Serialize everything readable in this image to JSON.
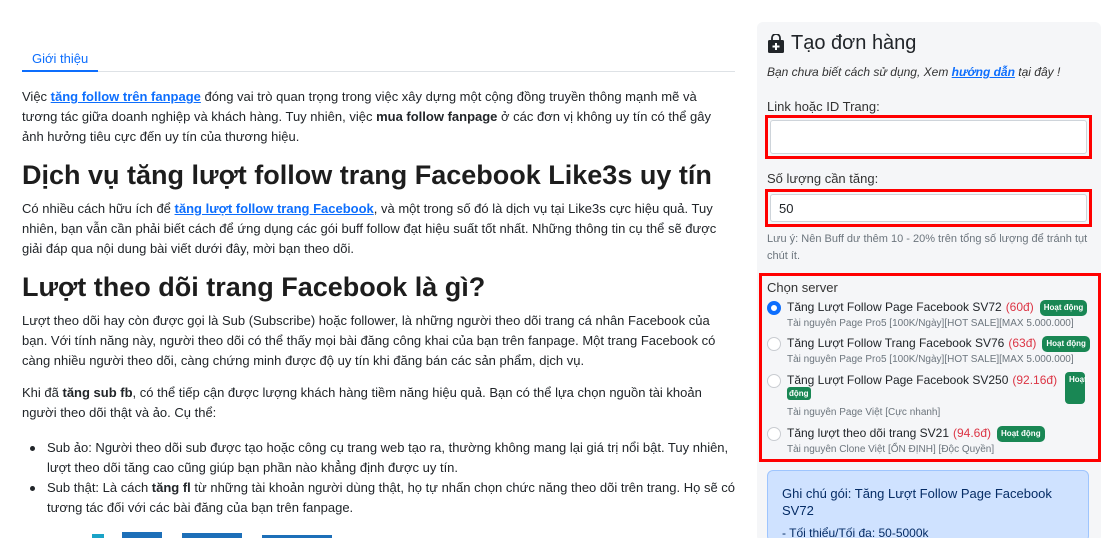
{
  "article": {
    "tab_label": "Giới thiệu",
    "p1": {
      "before": "Việc ",
      "link": "tăng follow trên fanpage",
      "middle": " đóng vai trò quan trọng trong việc xây dựng một cộng đồng truyền thông mạnh mẽ và tương tác giữa doanh nghiệp và khách hàng. Tuy nhiên, việc ",
      "bold": "mua follow fanpage",
      "after": " ở các đơn vị không uy tín có thể gây ảnh hưởng tiêu cực đến uy tín của thương hiệu."
    },
    "h1": "Dịch vụ tăng lượt follow trang Facebook Like3s uy tín",
    "p2": {
      "before": "Có nhiều cách hữu ích để ",
      "link": "tăng lượt follow trang Facebook",
      "after": ", và một trong số đó là dịch vụ tại Like3s cực hiệu quả. Tuy nhiên, bạn vẫn cần phải biết cách để ứng dụng các gói buff follow đạt hiệu suất tốt nhất. Những thông tin cụ thể sẽ được giải đáp qua nội dung bài viết dưới đây, mời bạn theo dõi."
    },
    "h2": "Lượt theo dõi trang Facebook là gì?",
    "p3": "Lượt theo dõi hay còn được gọi là Sub (Subscribe) hoặc follower, là những người theo dõi trang cá nhân Facebook của bạn. Với tính năng này, người theo dõi có thể thấy mọi bài đăng công khai của bạn trên fanpage. Một trang Facebook có càng nhiều người theo dõi, càng chứng minh được độ uy tín khi đăng bán các sản phẩm, dịch vụ.",
    "p4": {
      "before": "Khi đã ",
      "bold": "tăng sub fb",
      "after": ", có thể tiếp cận được lượng khách hàng tiềm năng hiệu quả. Bạn có thể lựa chọn nguồn tài khoản người theo dõi thật và ảo. Cụ thể:"
    },
    "bullets": [
      {
        "text": "Sub ảo: Người theo dõi sub được tạo hoặc công cụ trang web tạo ra, thường không mang lại giá trị nổi bật. Tuy nhiên, lượt theo dõi tăng cao cũng giúp bạn phần nào khẳng định được uy tín."
      },
      {
        "before": "Sub thật: Là cách ",
        "bold": "tăng fl",
        "after": " từ những tài khoản người dùng thật, họ tự nhấn chọn chức năng theo dõi trên trang. Họ sẽ có tương tác đối với các bài đăng của bạn trên fanpage."
      }
    ]
  },
  "order": {
    "title": "Tạo đơn hàng",
    "hint_before": "Bạn chưa biết cách sử dụng, Xem ",
    "hint_link": "hướng dẫn",
    "hint_after": " tại đây !",
    "link_label": "Link hoặc ID Trang:",
    "link_value": "",
    "qty_label": "Số lượng cần tăng:",
    "qty_value": "50",
    "note": "Lưu ý: Nên Buff dư thêm 10 - 20% trên tổng số lượng để tránh tụt chút ít.",
    "server_label": "Chọn server",
    "servers": [
      {
        "name": "Tăng Lượt Follow Page Facebook SV72",
        "price": "(60đ)",
        "badge": "Hoạt động",
        "sub": "Tài nguyên Page Pro5 [100K/Ngày][HOT SALE][MAX 5.000.000]",
        "selected": true
      },
      {
        "name": "Tăng Lượt Follow Trang Facebook SV76",
        "price": "(63đ)",
        "badge": "Hoạt động",
        "sub": "Tài nguyên Page Pro5 [100K/Ngày][HOT SALE][MAX 5.000.000]",
        "selected": false
      },
      {
        "name": "Tăng Lượt Follow Page Facebook SV250",
        "price": "(92.16đ)",
        "badge_a": "Hoạt",
        "badge_b": "động",
        "sub": "Tài nguyên Page Việt [Cực nhanh]",
        "selected": false
      },
      {
        "name": "Tăng lượt theo dõi trang SV21",
        "price": "(94.6đ)",
        "badge": "Hoạt động",
        "sub": "Tài nguyên Clone Việt [ỔN ĐỊNH] [Độc Quyền]",
        "selected": false
      }
    ],
    "info_title": "Ghi chú gói: Tăng Lượt Follow Page Facebook SV72",
    "info_line": "- Tối thiểu/Tối đa: 50-5000k"
  },
  "colors": {
    "accent": "#0d6efd",
    "highlight": "#ff0000",
    "price": "#dc3545",
    "badge": "#198754",
    "info_bg": "#cfe2ff"
  }
}
